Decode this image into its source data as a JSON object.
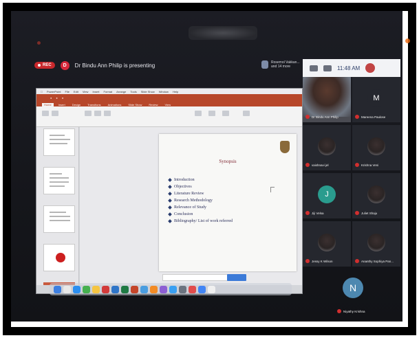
{
  "meeting": {
    "rec_label": "REC",
    "presenter_initial": "D",
    "presenter_text": "Dr Bindu Ann Philip is presenting",
    "viewers_text": "Rosemol Vakkan... and 14 more",
    "time": "11:48 AM"
  },
  "slide": {
    "title": "Synopsis",
    "items": [
      "Introduction",
      "Objectives",
      "Literature Review",
      "Research Methodology",
      "Relevance of Study",
      "Conclusion",
      "Bibliography/ List of work referred"
    ]
  },
  "participants": [
    {
      "name": "Dr Bindu Ann Philip",
      "initial": "",
      "avatar": "photo"
    },
    {
      "name": "Mareena Paulose",
      "initial": "M",
      "avatar": "letter",
      "color": "#25272e"
    },
    {
      "name": "vaishnavi jel",
      "initial": "",
      "avatar": "image"
    },
    {
      "name": "Krishna Veni",
      "initial": "",
      "avatar": "image"
    },
    {
      "name": "Jiji Velsa",
      "initial": "J",
      "avatar": "letter",
      "color": "#2a9c8e"
    },
    {
      "name": "Juliet Shaju",
      "initial": "",
      "avatar": "image"
    },
    {
      "name": "Jessy K Wilson",
      "initial": "",
      "avatar": "image"
    },
    {
      "name": "Ananthy Sophiya Pan...",
      "initial": "",
      "avatar": "image"
    },
    {
      "name": "Niyathy Krishna",
      "initial": "N",
      "avatar": "letter",
      "color": "#4d88b0"
    }
  ],
  "colors": {
    "rec": "#c8282c",
    "ppt_ribbon": "#b7472a",
    "slide_title": "#7b1f2b",
    "screen_bg": "#15161b"
  }
}
